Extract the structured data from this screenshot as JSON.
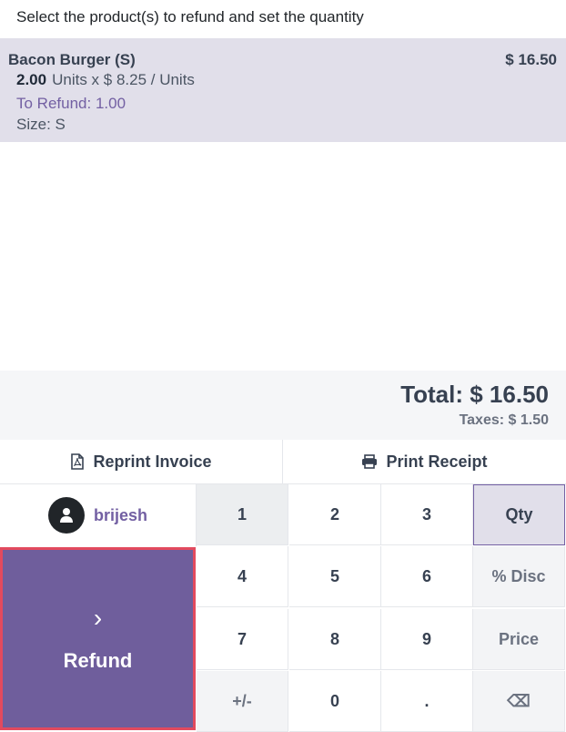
{
  "instruction": "Select the product(s) to refund and set the quantity",
  "orderline": {
    "product_name": "Bacon Burger (S)",
    "price": "$ 16.50",
    "qty": "2.00",
    "unit_price_text": "Units x $ 8.25 / Units",
    "to_refund": "To Refund: 1.00",
    "attribute": "Size: S"
  },
  "totals": {
    "total": "Total: $ 16.50",
    "taxes": "Taxes: $ 1.50"
  },
  "actions": {
    "reprint_label": "Reprint Invoice",
    "print_label": "Print Receipt"
  },
  "customer": {
    "name": "brijesh"
  },
  "refund_button": {
    "label": "Refund",
    "chevron": "›"
  },
  "numpad": {
    "k1": "1",
    "k2": "2",
    "k3": "3",
    "qty": "Qty",
    "k4": "4",
    "k5": "5",
    "k6": "6",
    "disc": "% Disc",
    "k7": "7",
    "k8": "8",
    "k9": "9",
    "price": "Price",
    "sign": "+/-",
    "k0": "0",
    "dot": ".",
    "backspace": "⌫"
  },
  "colors": {
    "accent": "#7360a3",
    "selected_line": "#e1dfea",
    "refund_border": "#e24a5e"
  }
}
